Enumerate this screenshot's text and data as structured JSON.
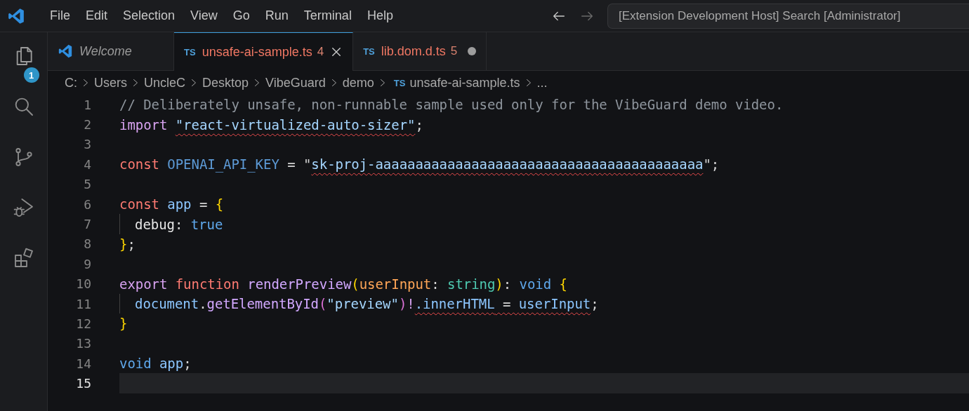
{
  "title_bar": {
    "menu": [
      "File",
      "Edit",
      "Selection",
      "View",
      "Go",
      "Run",
      "Terminal",
      "Help"
    ],
    "command_center": "[Extension Development Host] Search [Administrator]"
  },
  "activity_bar": [
    {
      "kind": "explorer",
      "badge": "1"
    },
    {
      "kind": "search"
    },
    {
      "kind": "source-control"
    },
    {
      "kind": "run-debug"
    },
    {
      "kind": "extensions"
    }
  ],
  "tabs": [
    {
      "label": "Welcome",
      "kind": "welcome",
      "preview": true,
      "selected": false,
      "has_errors": false,
      "modified": false
    },
    {
      "label": "unsafe-ai-sample.ts",
      "kind": "ts",
      "icon_text": "TS",
      "problems": "4",
      "preview": false,
      "selected": true,
      "has_errors": true,
      "modified": false
    },
    {
      "label": "lib.dom.d.ts",
      "kind": "ts",
      "icon_text": "TS",
      "problems": "5",
      "preview": false,
      "selected": false,
      "has_errors": true,
      "modified": true
    }
  ],
  "breadcrumb": [
    {
      "label": "C:"
    },
    {
      "label": "Users"
    },
    {
      "label": "UncleC"
    },
    {
      "label": "Desktop"
    },
    {
      "label": "VibeGuard"
    },
    {
      "label": "demo"
    },
    {
      "label": "unsafe-ai-sample.ts",
      "icon_text": "TS"
    },
    {
      "label": "..."
    }
  ],
  "editor": {
    "lines": [
      {
        "number": "1",
        "current": false,
        "guide": false,
        "tokens": [
          {
            "text": "// Deliberately unsafe, non-runnable sample used only for the VibeGuard demo video.",
            "kind": "comment"
          }
        ]
      },
      {
        "number": "2",
        "current": false,
        "guide": false,
        "tokens": [
          {
            "text": "import ",
            "kind": "control"
          },
          {
            "text": "\"react-virtualized-auto-sizer\"",
            "kind": "string",
            "error": true
          },
          {
            "text": ";",
            "kind": "plain"
          }
        ]
      },
      {
        "number": "3",
        "current": false,
        "guide": false
      },
      {
        "number": "4",
        "current": false,
        "guide": false,
        "tokens": [
          {
            "text": "const ",
            "kind": "storage"
          },
          {
            "text": "OPENAI_API_KEY",
            "kind": "constant"
          },
          {
            "text": " = \"",
            "kind": "plain"
          },
          {
            "text": "sk-proj-aaaaaaaaaaaaaaaaaaaaaaaaaaaaaaaaaaaaaaaaa",
            "kind": "string",
            "error": true
          },
          {
            "text": "\";",
            "kind": "plain"
          }
        ]
      },
      {
        "number": "5",
        "current": false,
        "guide": false
      },
      {
        "number": "6",
        "current": false,
        "guide": false,
        "tokens": [
          {
            "text": "const ",
            "kind": "storage"
          },
          {
            "text": "app",
            "kind": "variable"
          },
          {
            "text": " = ",
            "kind": "plain"
          },
          {
            "text": "{",
            "kind": "bracket1"
          }
        ]
      },
      {
        "number": "7",
        "current": false,
        "guide": true,
        "tokens": [
          {
            "text": "debug",
            "kind": "property"
          },
          {
            "text": ": ",
            "kind": "plain"
          },
          {
            "text": "true",
            "kind": "literal"
          }
        ]
      },
      {
        "number": "8",
        "current": false,
        "guide": false,
        "tokens": [
          {
            "text": "}",
            "kind": "bracket1"
          },
          {
            "text": ";",
            "kind": "plain"
          }
        ]
      },
      {
        "number": "9",
        "current": false,
        "guide": false
      },
      {
        "number": "10",
        "current": false,
        "guide": false,
        "tokens": [
          {
            "text": "export ",
            "kind": "control"
          },
          {
            "text": "function ",
            "kind": "storage"
          },
          {
            "text": "renderPreview",
            "kind": "function"
          },
          {
            "text": "(",
            "kind": "bracket1"
          },
          {
            "text": "userInput",
            "kind": "parameter"
          },
          {
            "text": ": ",
            "kind": "plain"
          },
          {
            "text": "string",
            "kind": "type"
          },
          {
            "text": ")",
            "kind": "bracket1"
          },
          {
            "text": ": ",
            "kind": "plain"
          },
          {
            "text": "void ",
            "kind": "literal"
          },
          {
            "text": "{",
            "kind": "bracket1"
          }
        ]
      },
      {
        "number": "11",
        "current": false,
        "guide": true,
        "tokens": [
          {
            "text": "document",
            "kind": "variable"
          },
          {
            "text": ".",
            "kind": "plain"
          },
          {
            "text": "getElementById",
            "kind": "function"
          },
          {
            "text": "(",
            "kind": "bracket2"
          },
          {
            "text": "\"preview\"",
            "kind": "string"
          },
          {
            "text": ")",
            "kind": "bracket2"
          },
          {
            "text": "!",
            "kind": "control"
          },
          {
            "text": ".innerHTML",
            "kind": "variable",
            "error": true
          },
          {
            "text": " = ",
            "kind": "plain",
            "error": true
          },
          {
            "text": "userInput",
            "kind": "variable",
            "error": true
          },
          {
            "text": ";",
            "kind": "plain"
          }
        ]
      },
      {
        "number": "12",
        "current": false,
        "guide": false,
        "tokens": [
          {
            "text": "}",
            "kind": "bracket1"
          }
        ]
      },
      {
        "number": "13",
        "current": false,
        "guide": false
      },
      {
        "number": "14",
        "current": false,
        "guide": false,
        "tokens": [
          {
            "text": "void ",
            "kind": "literal"
          },
          {
            "text": "app",
            "kind": "variable"
          },
          {
            "text": ";",
            "kind": "plain"
          }
        ]
      },
      {
        "number": "15",
        "current": true,
        "guide": false
      }
    ]
  }
}
